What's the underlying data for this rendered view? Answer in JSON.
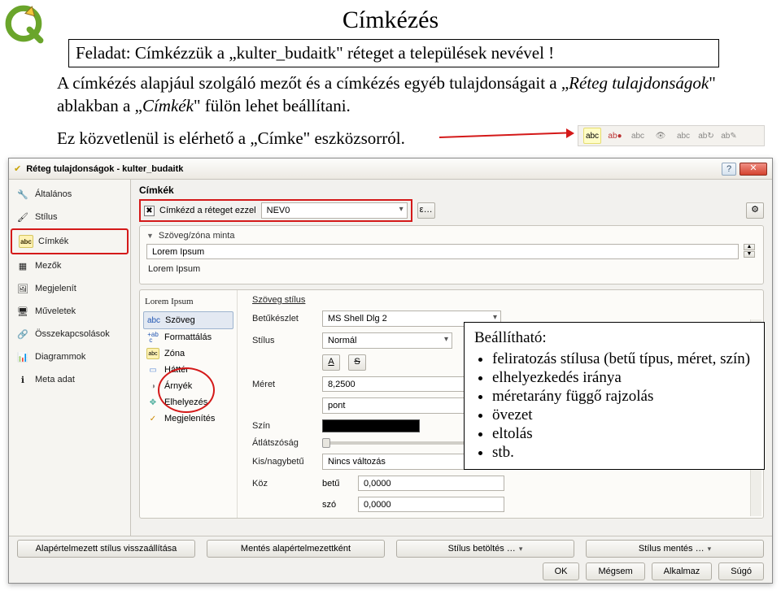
{
  "page": {
    "title": "Címkézés",
    "task": "Feladat: Címkézzük a „kulter_budaitk\" réteget a települések nevével !",
    "desc_pre": "A címkézés alapjául szolgáló mezőt és a címkézés egyéb tulajdonságait a „",
    "desc_em1": "Réteg tulajdonságok",
    "desc_mid": "\" ablakban a „",
    "desc_em2": "Címkék",
    "desc_post": "\" fülön lehet beállítani.",
    "desc2_pre": "Ez közvetlenül is elérhető a „",
    "desc2_em": "Címke",
    "desc2_post": "\" eszközsorról."
  },
  "toolbar_icons": [
    "abc",
    "abc",
    "abc",
    "abc",
    "abc",
    "abc",
    "abc"
  ],
  "dialog": {
    "title": "Réteg tulajdonságok - kulter_budaitk",
    "help": "?",
    "close": "✕",
    "sidebar": [
      {
        "icon": "wrench",
        "label": "Általános"
      },
      {
        "icon": "brush",
        "label": "Stílus"
      },
      {
        "icon": "abc",
        "label": "Címkék"
      },
      {
        "icon": "table",
        "label": "Mezők"
      },
      {
        "icon": "render",
        "label": "Megjelenít"
      },
      {
        "icon": "monitor",
        "label": "Műveletek"
      },
      {
        "icon": "join",
        "label": "Összekapcsolások"
      },
      {
        "icon": "chart",
        "label": "Diagrammok"
      },
      {
        "icon": "info",
        "label": "Meta adat"
      }
    ],
    "main": {
      "section": "Címkék",
      "label_with_check": "Címkézd a réteget ezzel",
      "field_combo": "NEV0",
      "eps_btn": "ε…",
      "sample_header": "Szöveg/zóna minta",
      "sample_text": "Lorem Ipsum",
      "preview_header": "Lorem Ipsum",
      "settings_list": [
        {
          "icon": "abc",
          "label": "Szöveg"
        },
        {
          "icon": "fmt",
          "label": "Formattálás"
        },
        {
          "icon": "abc",
          "label": "Zóna"
        },
        {
          "icon": "bg",
          "label": "Háttér"
        },
        {
          "icon": "shadow",
          "label": "Árnyék"
        },
        {
          "icon": "place",
          "label": "Elhelyezés"
        },
        {
          "icon": "render",
          "label": "Megjelenítés"
        }
      ],
      "form": {
        "style_lbl": "Szöveg stílus",
        "font_lbl": "Betűkészlet",
        "font_val": "MS Shell Dlg 2",
        "stilus_lbl": "Stílus",
        "stilus_val": "Normál",
        "underline": "A",
        "strike": "S",
        "size_lbl": "Méret",
        "size_val": "8,2500",
        "size_unit": "pont",
        "color_lbl": "Szín",
        "opacity_lbl": "Átlátszóság",
        "case_lbl": "Kis/nagybetű",
        "case_val": "Nincs változás",
        "spacing_lbl": "Köz",
        "spacing_mode": "betű",
        "spacing_val": "0,0000",
        "word_lbl": "szó",
        "word_val": "0,0000"
      }
    },
    "footer": {
      "row1": [
        "Alapértelmezett stílus visszaállítása",
        "Mentés alapértelmezettként",
        "Stílus betöltés …",
        "Stílus mentés …"
      ],
      "row2": [
        "OK",
        "Mégsem",
        "Alkalmaz",
        "Súgó"
      ]
    }
  },
  "callout": {
    "title": "Beállítható:",
    "items": [
      "feliratozás stílusa (betű típus, méret, szín)",
      "elhelyezkedés iránya",
      "méretarány függő rajzolás",
      "övezet",
      "eltolás",
      "stb."
    ]
  }
}
